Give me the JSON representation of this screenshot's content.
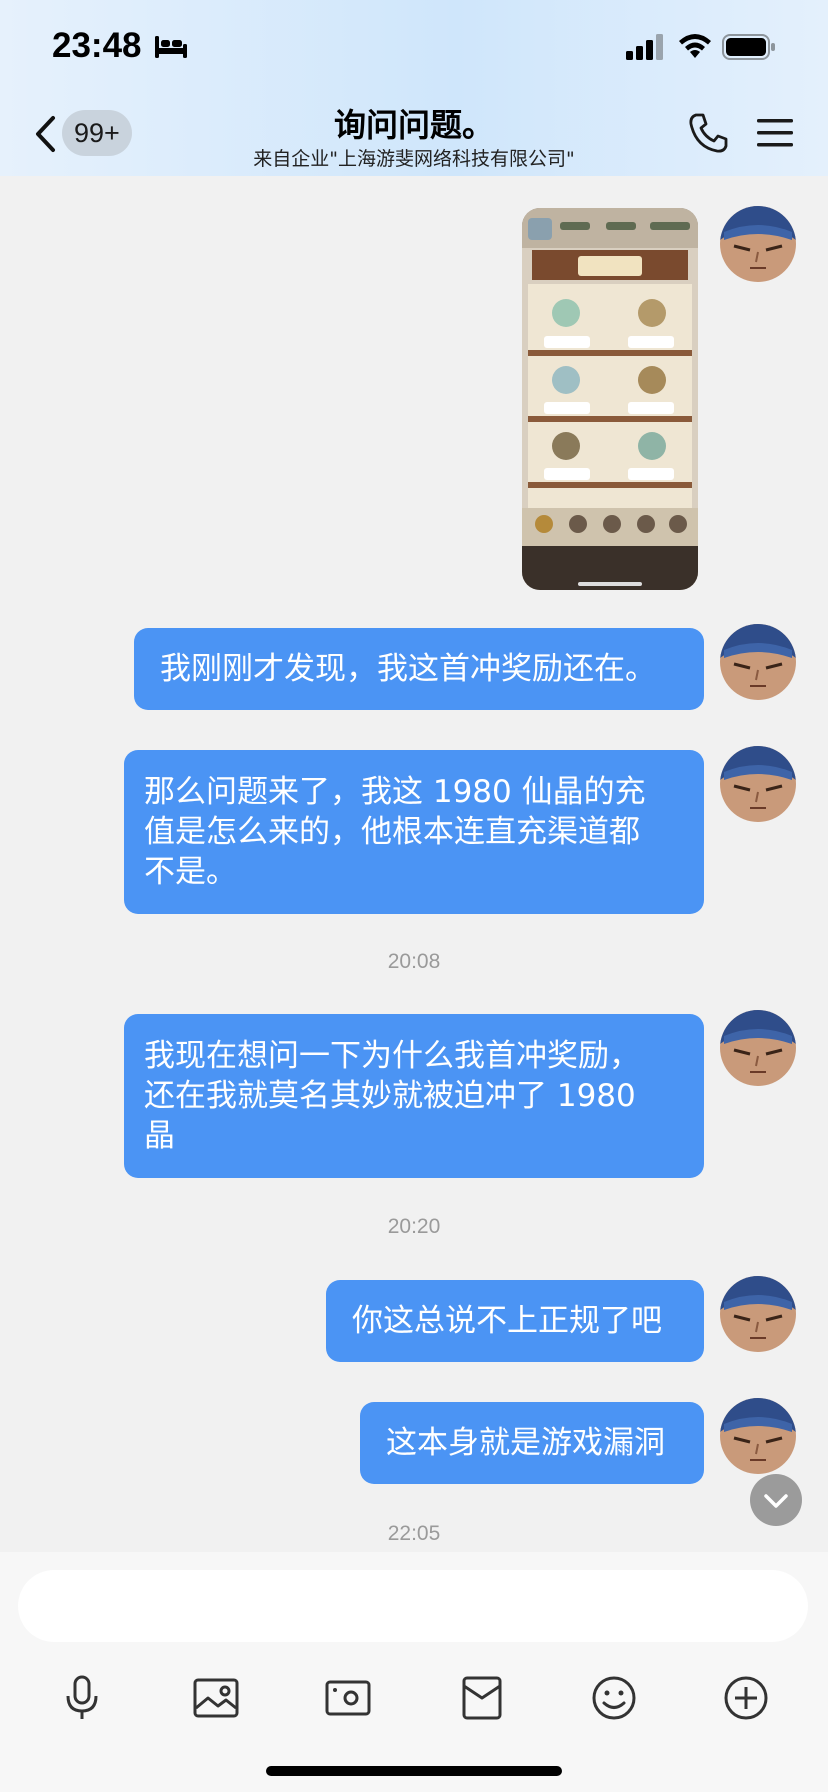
{
  "status_bar": {
    "time": "23:48"
  },
  "nav": {
    "back_badge": "99+",
    "title": "询问问题。",
    "subtitle": "来自企业\"上海游斐网络科技有限公司\""
  },
  "messages": [
    {
      "type": "image",
      "description_icon": "game-shop-screenshot"
    },
    {
      "type": "text",
      "text": "我刚刚才发现，我这首冲奖励还在。"
    },
    {
      "type": "text",
      "lines": [
        "那么问题来了，我这 1980 仙晶的充",
        "值是怎么来的，他根本连直充渠道都",
        "不是。"
      ]
    },
    {
      "type": "timestamp",
      "text": "20:08"
    },
    {
      "type": "text",
      "lines": [
        "我现在想问一下为什么我首冲奖励，",
        "还在我就莫名其妙就被迫冲了 1980",
        "晶"
      ]
    },
    {
      "type": "timestamp",
      "text": "20:20"
    },
    {
      "type": "text",
      "text": "你这总说不上正规了吧"
    },
    {
      "type": "text",
      "text": "这本身就是游戏漏洞"
    },
    {
      "type": "timestamp",
      "text": "22:05"
    }
  ],
  "toolbar": {
    "icons": [
      "microphone-icon",
      "photo-icon",
      "camera-icon",
      "red-packet-icon",
      "emoji-icon",
      "plus-icon"
    ]
  },
  "colors": {
    "bubble": "#4b94f4",
    "header_gradient_mid": "#cfe6fb"
  }
}
